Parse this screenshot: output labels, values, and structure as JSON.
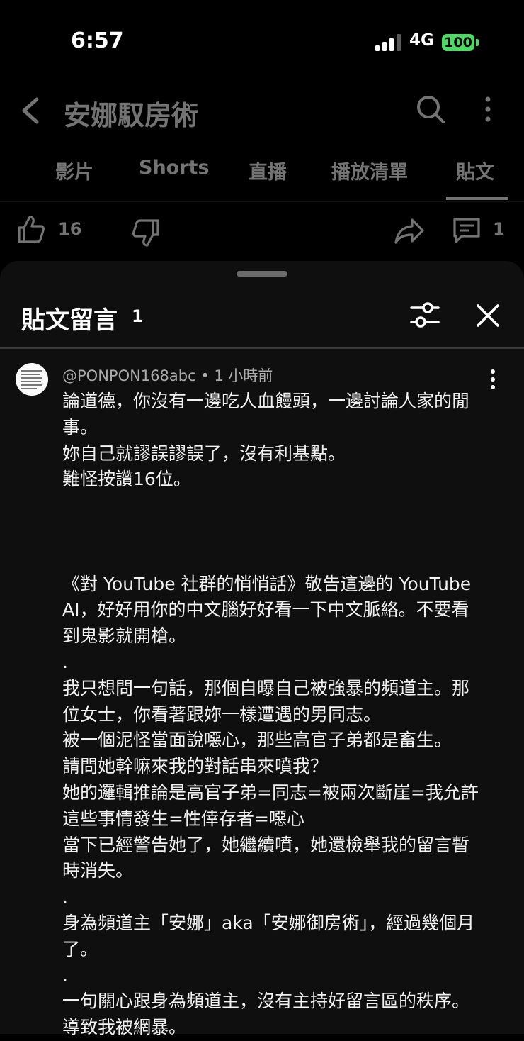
{
  "status_bar": {
    "time": "6:57",
    "network": "4G",
    "battery": "100"
  },
  "header": {
    "title": "安娜馭房術"
  },
  "tabs": [
    {
      "label": "影片"
    },
    {
      "label": "Shorts"
    },
    {
      "label": "直播"
    },
    {
      "label": "播放清單"
    },
    {
      "label": "貼文",
      "selected": true
    }
  ],
  "actions": {
    "likes": "16",
    "comments": "1"
  },
  "sheet": {
    "title": "貼文留言",
    "count": "1"
  },
  "comment": {
    "author": "@PONPON168abc",
    "time": "• 1 小時前",
    "lines": [
      "論道德，你沒有一邊吃人血饅頭，一邊討論人家的閒",
      "事。",
      "妳自己就謬誤謬誤了，沒有利基點。",
      "難怪按讚16位。",
      "",
      "",
      "",
      "《對 YouTube 社群的悄悄話》敬告這邊的 YouTube",
      "AI，好好用你的中文腦好好看一下中文脈絡。不要看",
      "到鬼影就開槍。",
      ".",
      "我只想問一句話，那個自曝自己被強暴的頻道主。那",
      "位女士，你看著跟妳一樣遭遇的男同志。",
      "被一個泥怪當面說噁心，那些高官子弟都是畜生。",
      "請問她幹嘛來我的對話串來噴我？",
      "她的邏輯推論是高官子弟=同志=被兩次斷崖=我允許",
      "這些事情發生=性倖存者=噁心",
      "當下已經警告她了，她繼續噴，她還檢舉我的留言暫",
      "時消失。",
      ".",
      "身為頻道主「安娜」aka「安娜御房術」，經過幾個月",
      "了。",
      ".",
      "一句關心跟身為頻道主，沒有主持好留言區的秩序。",
      "導致我被網暴。"
    ]
  }
}
